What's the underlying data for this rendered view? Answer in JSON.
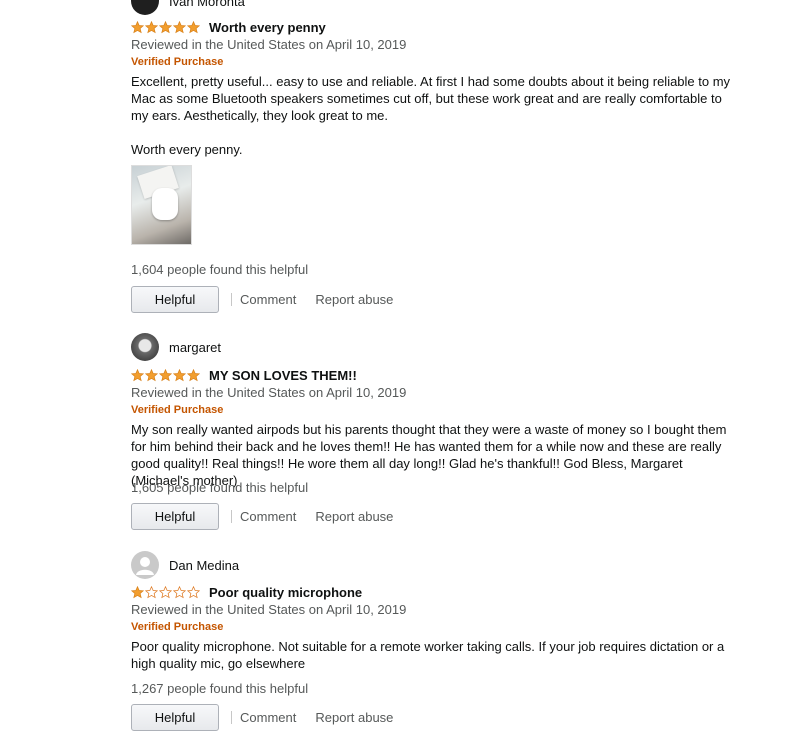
{
  "colors": {
    "star": "#f29e2e",
    "verified": "#c45500",
    "meta": "#565959"
  },
  "reviews": [
    {
      "reviewer": "Ivan Moronta",
      "rating": 5,
      "title": "Worth every penny",
      "date": "Reviewed in the United States on April 10, 2019",
      "verified": "Verified Purchase",
      "body": [
        "Excellent, pretty useful... easy to use and reliable. At first I had some doubts about it being reliable to my Mac as some Bluetooth speakers sometimes cut off, but these work great and are really comfortable to my ears. Aesthetically, they look great to me.",
        "Worth every penny."
      ],
      "helpful_count": "1,604 people found this helpful",
      "helpful_button": "Helpful",
      "comment_link": "Comment",
      "report_link": "Report abuse"
    },
    {
      "reviewer": "margaret",
      "rating": 5,
      "title": "MY SON LOVES THEM!!",
      "date": "Reviewed in the United States on April 10, 2019",
      "verified": "Verified Purchase",
      "body": [
        "My son really wanted airpods but his parents thought that they were a waste of money so I bought them for him behind their back and he loves them!! He has wanted them for a while now and these are really good quality!! Real things!! He wore them all day long!! Glad he's thankful!! God Bless, Margaret (Michael's mother)"
      ],
      "helpful_count": "1,605 people found this helpful",
      "helpful_button": "Helpful",
      "comment_link": "Comment",
      "report_link": "Report abuse"
    },
    {
      "reviewer": "Dan Medina",
      "rating": 1,
      "title": "Poor quality microphone",
      "date": "Reviewed in the United States on April 10, 2019",
      "verified": "Verified Purchase",
      "body": [
        "Poor quality microphone. Not suitable for a remote worker taking calls. If your job requires dictation or a high quality mic, go elsewhere"
      ],
      "helpful_count": "1,267 people found this helpful",
      "helpful_button": "Helpful",
      "comment_link": "Comment",
      "report_link": "Report abuse"
    }
  ]
}
